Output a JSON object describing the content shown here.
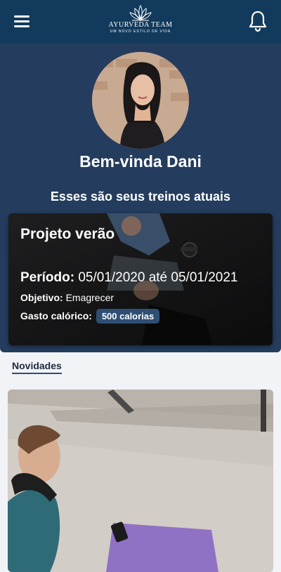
{
  "header": {
    "brand": "AYURVEDA TEAM",
    "tagline": "UM NOVO ESTILO DE VIDA",
    "menu_icon": "hamburger-menu-icon",
    "notification_icon": "bell-icon"
  },
  "hero": {
    "greeting": "Bem-vinda Dani",
    "subtitle": "Esses são seus treinos atuais"
  },
  "workout": {
    "title": "Projeto verão",
    "period_label": "Período:",
    "period_value": "05/01/2020 até 05/01/2021",
    "goal_label": "Objetivo:",
    "goal_value": "Emagrecer",
    "calories_label": "Gasto calórico:",
    "calories_value": "500 calorias"
  },
  "news": {
    "tab_label": "Novidades"
  },
  "colors": {
    "header_bg": "#123a5c",
    "hero_bg": "#243c5d",
    "badge_bg": "#2f4e74",
    "page_bg": "#f1f3f7"
  }
}
